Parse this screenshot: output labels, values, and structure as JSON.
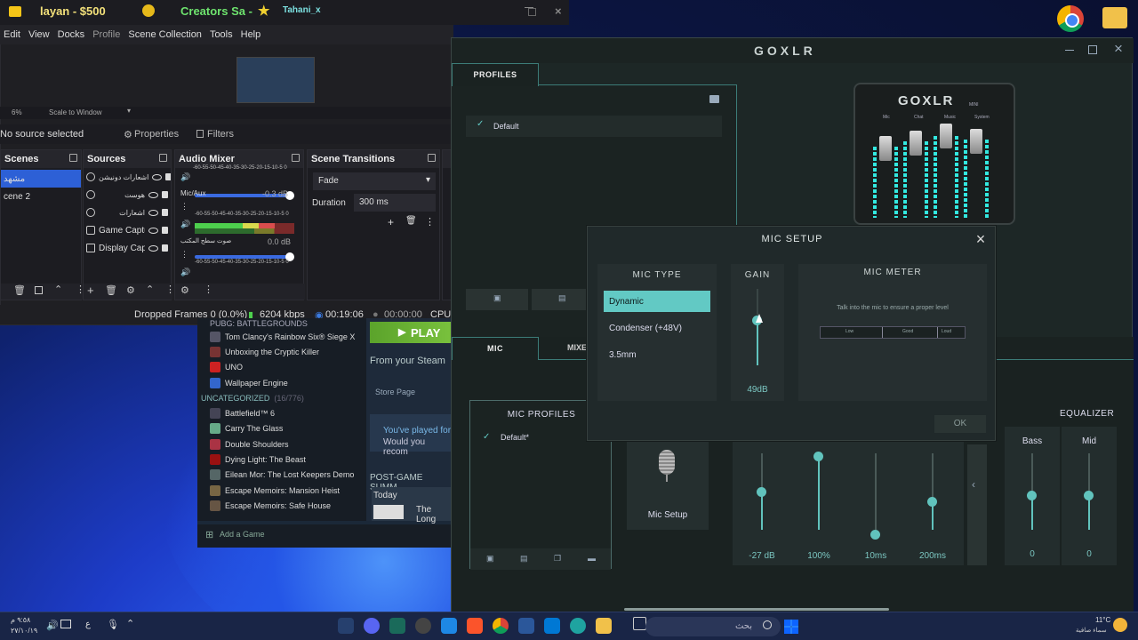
{
  "obs": {
    "title_parts": [
      "layan - $500",
      "Creators Sa -",
      "Tahani_x"
    ],
    "menu": [
      "Edit",
      "View",
      "Docks",
      "Profile",
      "Scene Collection",
      "Tools",
      "Help"
    ],
    "zoom": "6%",
    "scale": "Scale to Window",
    "no_source": "No source selected",
    "properties": "Properties",
    "filters": "Filters",
    "scenes_title": "Scenes",
    "scenes": [
      "مشهد",
      "cene 2"
    ],
    "sources_title": "Sources",
    "sources": [
      "اشعارات دونيشن",
      "هوست",
      "اشعارات",
      "Game Capture",
      "Display Capture"
    ],
    "mixer_title": "Audio Mixer",
    "mixer_scale": "-60-55-50-45-40-35-30-25-20-15-10-5 0",
    "mixer_channels": [
      {
        "name": "Mic/Aux",
        "db": "-0.3 dB"
      },
      {
        "name": "صوت سطح المكتب",
        "db": "0.0 dB"
      }
    ],
    "transitions_title": "Scene Transitions",
    "transition": "Fade",
    "duration_label": "Duration",
    "duration": "300 ms",
    "status": {
      "dropped": "Dropped Frames 0 (0.0%)",
      "kbps": "6204 kbps",
      "live": "00:19:06",
      "rec": "00:00:00",
      "cpu": "CPU:"
    }
  },
  "steam": {
    "games": [
      "PUBG: BATTLEGROUNDS",
      "Tom Clancy's Rainbow Six® Siege X",
      "Unboxing the Cryptic Killer",
      "UNO",
      "Wallpaper Engine"
    ],
    "uncat_label": "UNCATEGORIZED",
    "uncat_count": "(16/776)",
    "uncat_games": [
      "Battlefield™ 6",
      "Carry The Glass",
      "Double Shoulders",
      "Dying Light: The Beast",
      "Eilean Mor: The Lost Keepers Demo",
      "Escape Memoirs: Mansion Heist",
      "Escape Memoirs: Safe House"
    ],
    "play": "PLAY",
    "from_steam": "From your Steam",
    "store_page": "Store Page",
    "played_for": "You've played for",
    "would_you": "Would you recom",
    "post_game": "POST-GAME SUMM",
    "today": "Today",
    "the_long": "The Long",
    "add_game": "Add a Game"
  },
  "goxlr": {
    "logo": "GOXLR",
    "profiles_tab": "PROFILES",
    "default_profile": "Default",
    "hw_logo": "GOXLR",
    "hw_mini": "MINI",
    "hw_labels": [
      "Mic",
      "Chat",
      "Music",
      "System"
    ],
    "mic_tab": "MIC",
    "mixer_tab": "MIXE",
    "mic_profiles_title": "MIC PROFILES",
    "mic_profile_default": "Default*",
    "mic_setup_label": "Mic Setup",
    "equalizer": "EQUALIZER",
    "eq_bands": [
      {
        "label": "Bass",
        "value": "0"
      },
      {
        "label": "Mid",
        "value": "0"
      }
    ],
    "mic_values": [
      "-27 dB",
      "100%",
      "10ms",
      "200ms"
    ]
  },
  "dialog": {
    "title": "MIC SETUP",
    "mic_type_title": "MIC TYPE",
    "mic_types": [
      "Dynamic",
      "Condenser (+48V)",
      "3.5mm"
    ],
    "selected_type": "Dynamic",
    "gain_title": "GAIN",
    "gain_value": "49dB",
    "meter_title": "MIC METER",
    "meter_hint": "Talk into the mic to ensure a proper level",
    "meter_marks": [
      "Low",
      "Good",
      "Loud"
    ],
    "ok": "OK"
  },
  "taskbar": {
    "search_placeholder": "بحث",
    "weather_temp": "11°C",
    "weather_desc": "سماء صافية",
    "clock_time": "٩:٥٨ م",
    "clock_date": "٢٧/١٠/١٩"
  },
  "colors": {
    "teal": "#62c9c4",
    "obs_select": "#2d60d6",
    "steam_play": "#5ba32b",
    "wall": "#0d1b4f"
  }
}
